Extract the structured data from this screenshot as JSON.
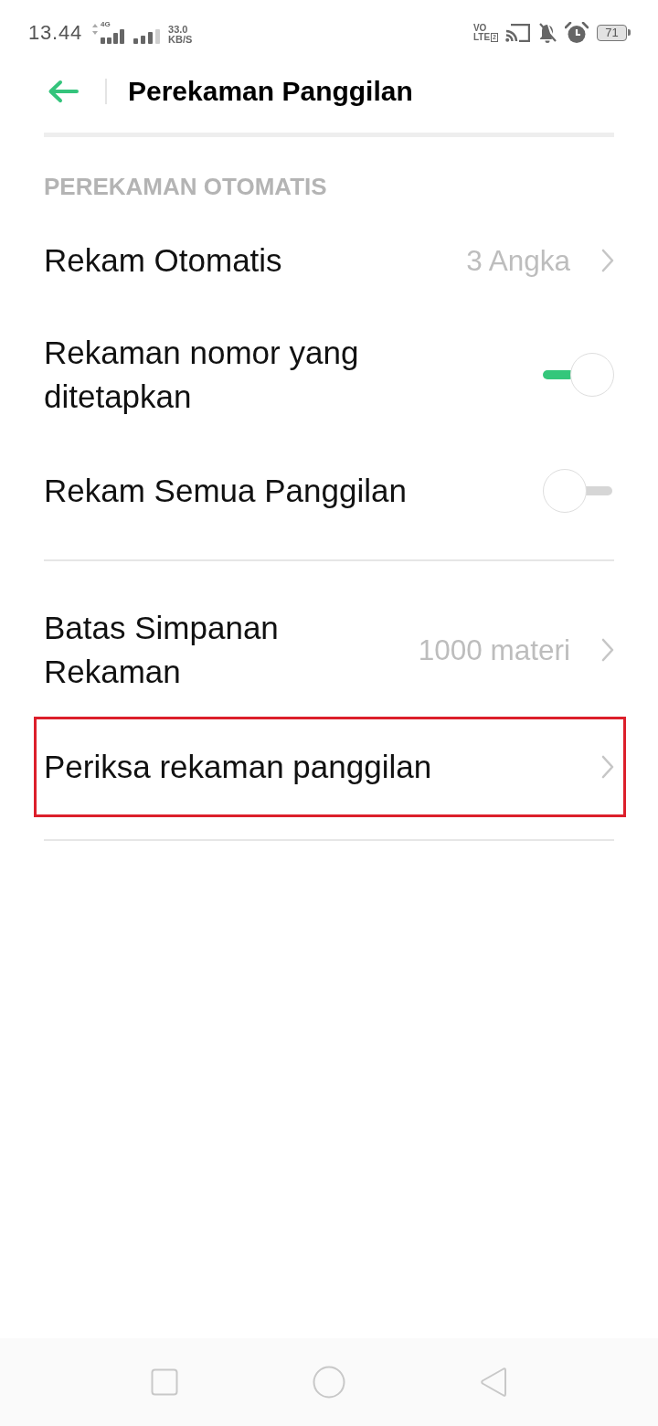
{
  "status_bar": {
    "time": "13.44",
    "network_type": "4G",
    "speed_value": "33.0",
    "speed_unit": "KB/S",
    "volte": {
      "top": "VO",
      "bottom": "LTE",
      "sim": "2"
    },
    "battery": "71"
  },
  "header": {
    "title": "Perekaman Panggilan"
  },
  "sections": [
    {
      "header": "PEREKAMAN OTOMATIS",
      "items": [
        {
          "kind": "value",
          "label": "Rekam Otomatis",
          "value": "3 Angka",
          "highlighted": false
        },
        {
          "kind": "toggle",
          "label": "Rekaman nomor yang ditetapkan",
          "on": true,
          "highlighted": false
        },
        {
          "kind": "toggle",
          "label": "Rekam Semua Panggilan",
          "on": false,
          "highlighted": false
        }
      ]
    },
    {
      "items": [
        {
          "kind": "value",
          "label": "Batas Simpanan Rekaman",
          "value": "1000 materi",
          "highlighted": false
        },
        {
          "kind": "link",
          "label": "Periksa rekaman panggilan",
          "highlighted": true
        }
      ]
    }
  ]
}
